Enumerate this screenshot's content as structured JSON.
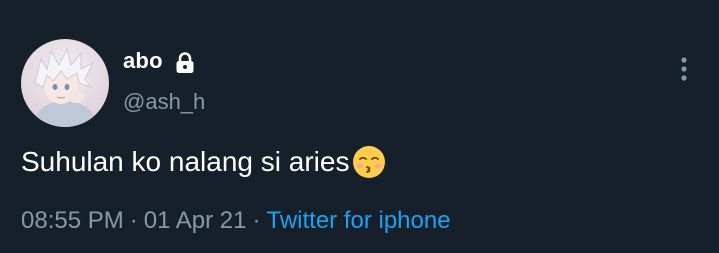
{
  "user": {
    "display_name": "abo",
    "handle": "@ash_h",
    "protected_icon": "lock-icon",
    "avatar_icon": "anime-avatar"
  },
  "tweet": {
    "text": "Suhulan ko nalang si aries",
    "emoji": "kissing-face-with-closed-eyes"
  },
  "meta": {
    "time": "08:55 PM",
    "separator": "·",
    "date": "01 Apr 21",
    "source": "Twitter for iphone"
  },
  "menu": {
    "icon": "more-vertical-icon"
  },
  "colors": {
    "background": "#15202b",
    "primary_text": "#ffffff",
    "secondary_text": "#8899a6",
    "link": "#1da1f2"
  }
}
